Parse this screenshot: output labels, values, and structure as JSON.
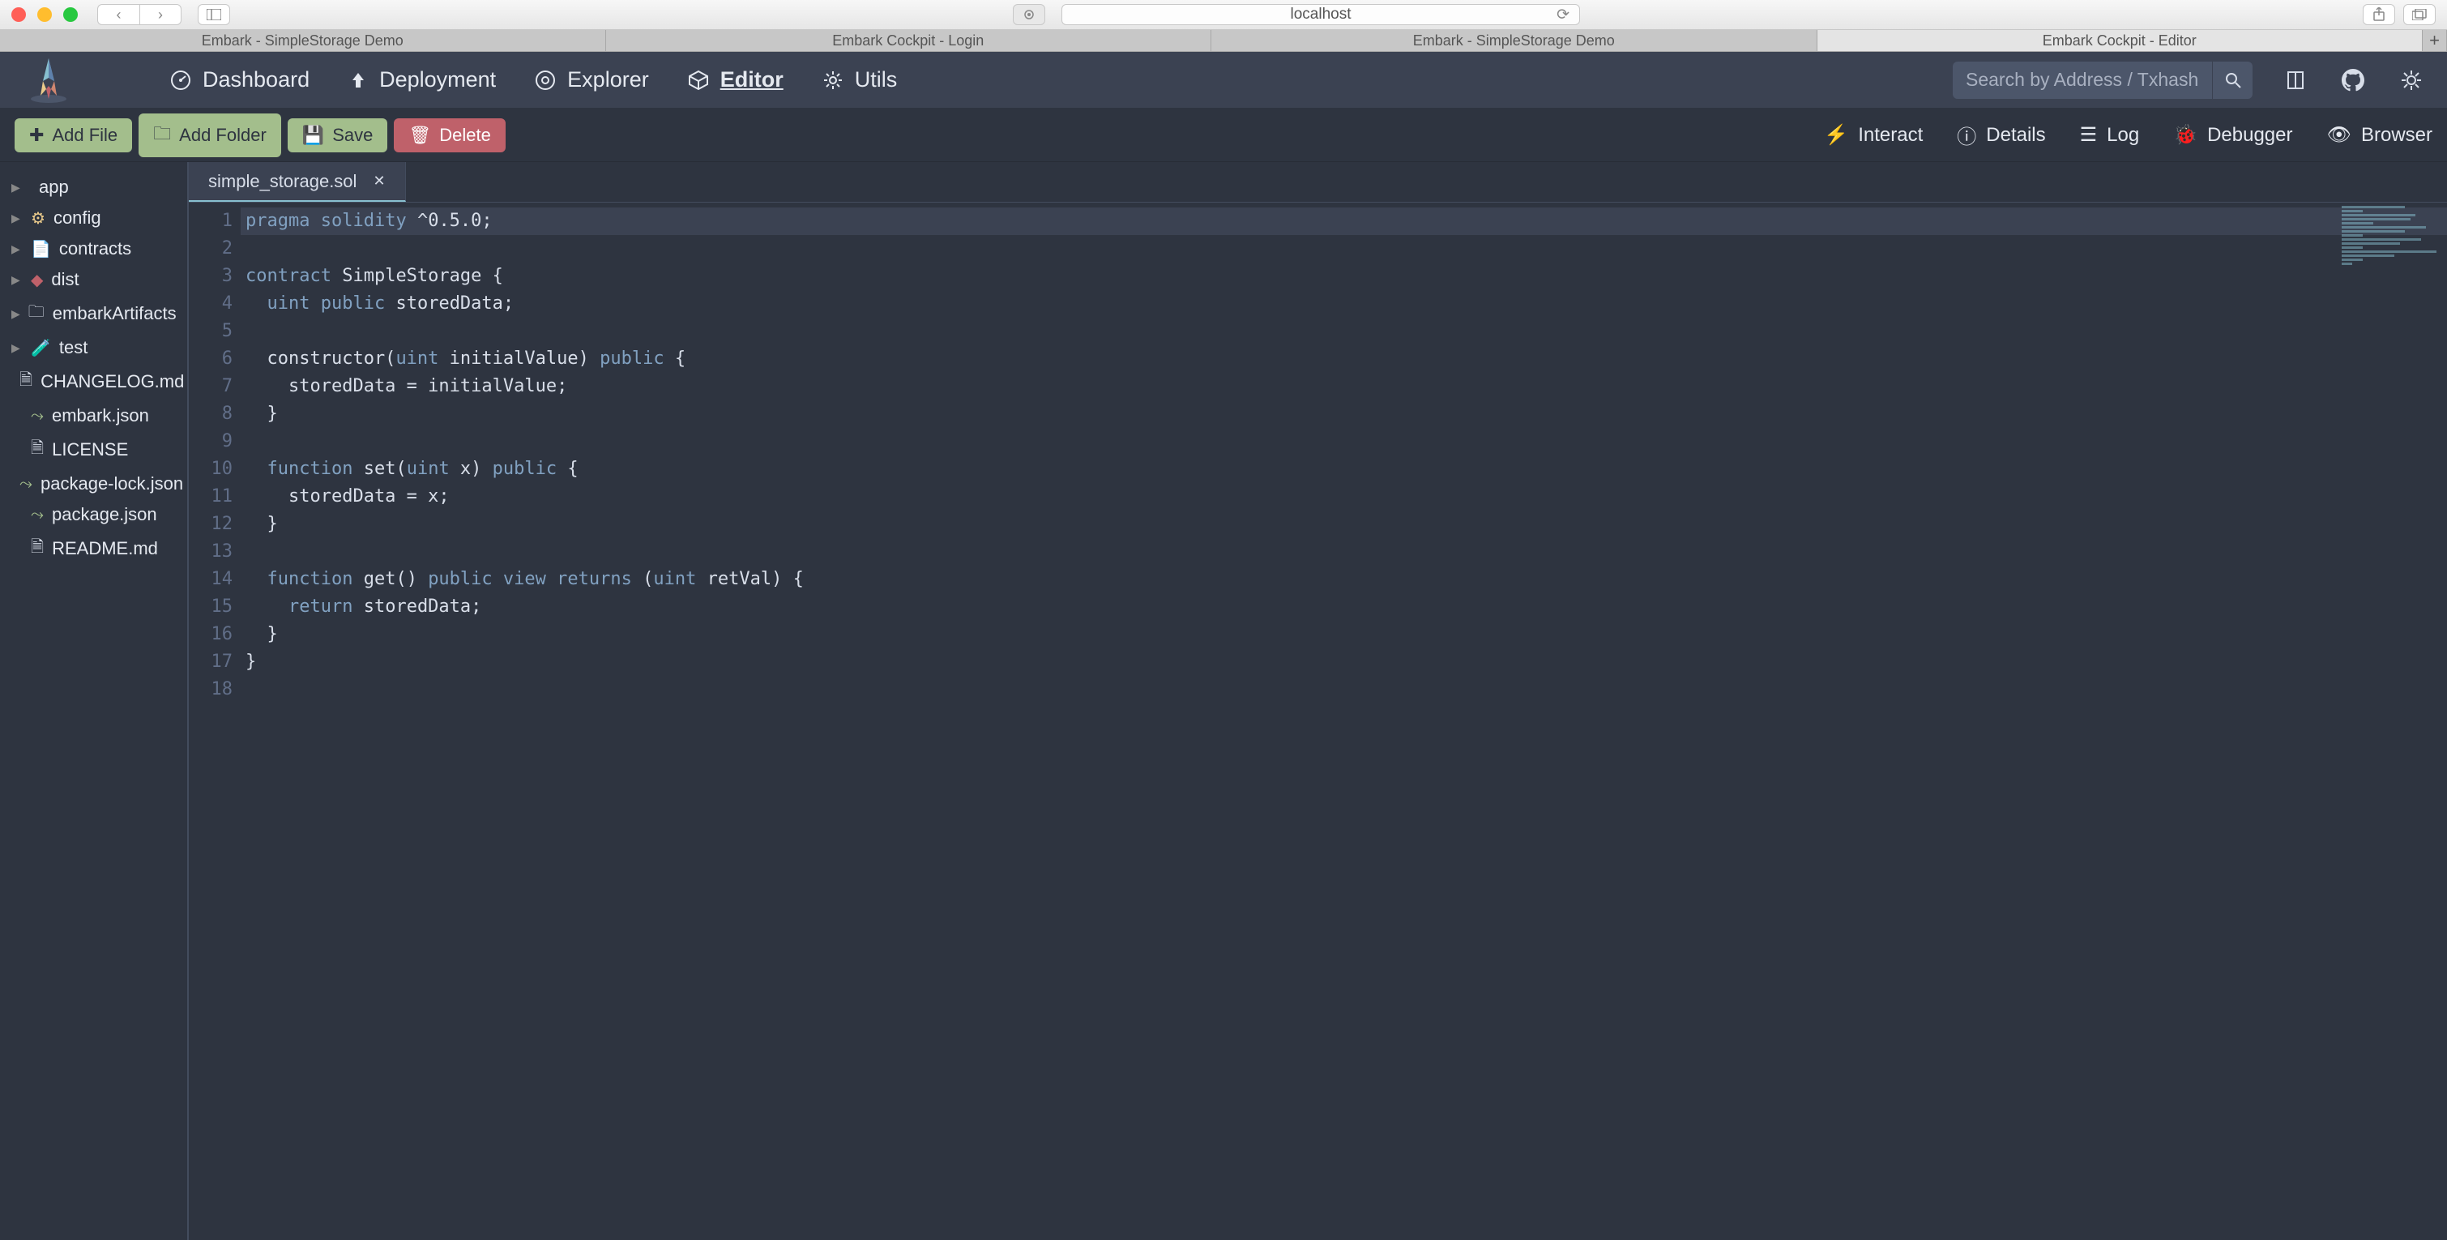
{
  "browser": {
    "url": "localhost",
    "tabs": [
      "Embark - SimpleStorage Demo",
      "Embark Cockpit - Login",
      "Embark - SimpleStorage Demo",
      "Embark Cockpit - Editor"
    ],
    "active_tab_index": 3
  },
  "nav": {
    "items": [
      {
        "label": "Dashboard",
        "icon": "dashboard-icon"
      },
      {
        "label": "Deployment",
        "icon": "upload-icon"
      },
      {
        "label": "Explorer",
        "icon": "compass-icon"
      },
      {
        "label": "Editor",
        "icon": "cube-icon",
        "active": true
      },
      {
        "label": "Utils",
        "icon": "gear-icon"
      }
    ],
    "search_placeholder": "Search by Address / Txhash / Block"
  },
  "toolbar": {
    "add_file": "Add File",
    "add_folder": "Add Folder",
    "save": "Save",
    "delete": "Delete",
    "panels": [
      {
        "label": "Interact",
        "icon": "bolt-icon"
      },
      {
        "label": "Details",
        "icon": "info-icon"
      },
      {
        "label": "Log",
        "icon": "list-icon"
      },
      {
        "label": "Debugger",
        "icon": "bug-icon"
      },
      {
        "label": "Browser",
        "icon": "eye-icon"
      }
    ]
  },
  "filetree": [
    {
      "label": "app",
      "type": "folder",
      "icon": "code"
    },
    {
      "label": "config",
      "type": "folder",
      "icon": "gear"
    },
    {
      "label": "contracts",
      "type": "folder",
      "icon": "doc"
    },
    {
      "label": "dist",
      "type": "folder",
      "icon": "dist"
    },
    {
      "label": "embarkArtifacts",
      "type": "folder",
      "icon": "folder"
    },
    {
      "label": "test",
      "type": "folder",
      "icon": "test"
    },
    {
      "label": "CHANGELOG.md",
      "type": "file",
      "icon": "file"
    },
    {
      "label": "embark.json",
      "type": "file",
      "icon": "json"
    },
    {
      "label": "LICENSE",
      "type": "file",
      "icon": "file"
    },
    {
      "label": "package-lock.json",
      "type": "file",
      "icon": "json"
    },
    {
      "label": "package.json",
      "type": "file",
      "icon": "json"
    },
    {
      "label": "README.md",
      "type": "file",
      "icon": "file"
    }
  ],
  "editor": {
    "open_file": "simple_storage.sol",
    "current_line": 1,
    "code_lines": [
      {
        "n": 1,
        "tokens": [
          {
            "t": "pragma",
            "c": "kw"
          },
          {
            "t": " "
          },
          {
            "t": "solidity",
            "c": "kw"
          },
          {
            "t": " ^0.5.0;"
          }
        ]
      },
      {
        "n": 2,
        "tokens": []
      },
      {
        "n": 3,
        "tokens": [
          {
            "t": "contract",
            "c": "kw"
          },
          {
            "t": " SimpleStorage {"
          }
        ]
      },
      {
        "n": 4,
        "tokens": [
          {
            "t": "  "
          },
          {
            "t": "uint",
            "c": "kw"
          },
          {
            "t": " "
          },
          {
            "t": "public",
            "c": "kw"
          },
          {
            "t": " storedData;"
          }
        ]
      },
      {
        "n": 5,
        "tokens": []
      },
      {
        "n": 6,
        "tokens": [
          {
            "t": "  constructor("
          },
          {
            "t": "uint",
            "c": "kw"
          },
          {
            "t": " initialValue) "
          },
          {
            "t": "public",
            "c": "kw"
          },
          {
            "t": " {"
          }
        ]
      },
      {
        "n": 7,
        "tokens": [
          {
            "t": "    storedData = initialValue;"
          }
        ]
      },
      {
        "n": 8,
        "tokens": [
          {
            "t": "  }"
          }
        ]
      },
      {
        "n": 9,
        "tokens": []
      },
      {
        "n": 10,
        "tokens": [
          {
            "t": "  "
          },
          {
            "t": "function",
            "c": "kw"
          },
          {
            "t": " set("
          },
          {
            "t": "uint",
            "c": "kw"
          },
          {
            "t": " x) "
          },
          {
            "t": "public",
            "c": "kw"
          },
          {
            "t": " {"
          }
        ]
      },
      {
        "n": 11,
        "tokens": [
          {
            "t": "    storedData = x;"
          }
        ]
      },
      {
        "n": 12,
        "tokens": [
          {
            "t": "  }"
          }
        ]
      },
      {
        "n": 13,
        "tokens": []
      },
      {
        "n": 14,
        "tokens": [
          {
            "t": "  "
          },
          {
            "t": "function",
            "c": "kw"
          },
          {
            "t": " get() "
          },
          {
            "t": "public",
            "c": "kw"
          },
          {
            "t": " "
          },
          {
            "t": "view",
            "c": "kw"
          },
          {
            "t": " "
          },
          {
            "t": "returns",
            "c": "kw"
          },
          {
            "t": " ("
          },
          {
            "t": "uint",
            "c": "kw"
          },
          {
            "t": " retVal) {"
          }
        ]
      },
      {
        "n": 15,
        "tokens": [
          {
            "t": "    "
          },
          {
            "t": "return",
            "c": "kw"
          },
          {
            "t": " storedData;"
          }
        ]
      },
      {
        "n": 16,
        "tokens": [
          {
            "t": "  }"
          }
        ]
      },
      {
        "n": 17,
        "tokens": [
          {
            "t": "}"
          }
        ]
      },
      {
        "n": 18,
        "tokens": []
      }
    ]
  },
  "colors": {
    "bg": "#2e3440",
    "panel": "#3b4252",
    "accent": "#88c0d0",
    "green": "#a3be8c",
    "red": "#bf616a"
  }
}
